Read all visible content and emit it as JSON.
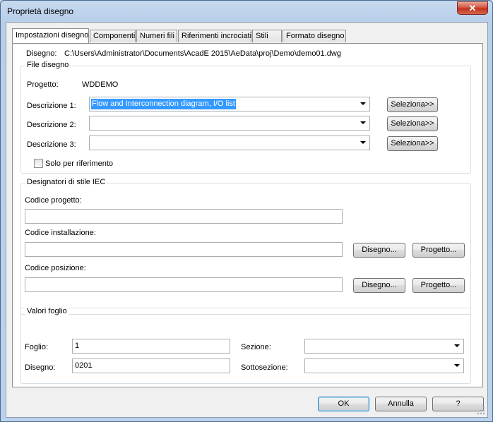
{
  "window": {
    "title": "Proprietà disegno",
    "close_glyph": "✕"
  },
  "tabs": [
    {
      "label": "Impostazioni disegno",
      "active": true
    },
    {
      "label": "Componenti"
    },
    {
      "label": "Numeri fili"
    },
    {
      "label": "Riferimenti incrociati"
    },
    {
      "label": "Stili"
    },
    {
      "label": "Formato disegno"
    }
  ],
  "drawing": {
    "label": "Disegno:",
    "path": "C:\\Users\\Administrator\\Documents\\AcadE 2015\\AeData\\proj\\Demo\\demo01.dwg"
  },
  "file_group": {
    "title": "File disegno",
    "project_label": "Progetto:",
    "project_value": "WDDEMO",
    "descriptions": [
      {
        "label": "Descrizione 1:",
        "value": "Flow and Interconnection diagram, I/O list",
        "button": "Seleziona>>"
      },
      {
        "label": "Descrizione 2:",
        "value": "",
        "button": "Seleziona>>"
      },
      {
        "label": "Descrizione 3:",
        "value": "",
        "button": "Seleziona>>"
      }
    ],
    "ref_only_label": "Solo per riferimento",
    "ref_only_checked": false
  },
  "iec_group": {
    "title": "Designatori di stile IEC",
    "project_code_label": "Codice progetto:",
    "project_code_value": "",
    "install_code_label": "Codice installazione:",
    "install_code_value": "",
    "location_code_label": "Codice posizione:",
    "location_code_value": "",
    "drawing_button": "Disegno...",
    "project_button": "Progetto..."
  },
  "sheet_group": {
    "title": "Valori foglio",
    "sheet_label": "Foglio:",
    "sheet_value": "1",
    "drawing_label": "Disegno:",
    "drawing_value": "0201",
    "section_label": "Sezione:",
    "section_value": "",
    "subsection_label": "Sottosezione:",
    "subsection_value": ""
  },
  "footer": {
    "ok": "OK",
    "cancel": "Annulla",
    "help": "?"
  }
}
